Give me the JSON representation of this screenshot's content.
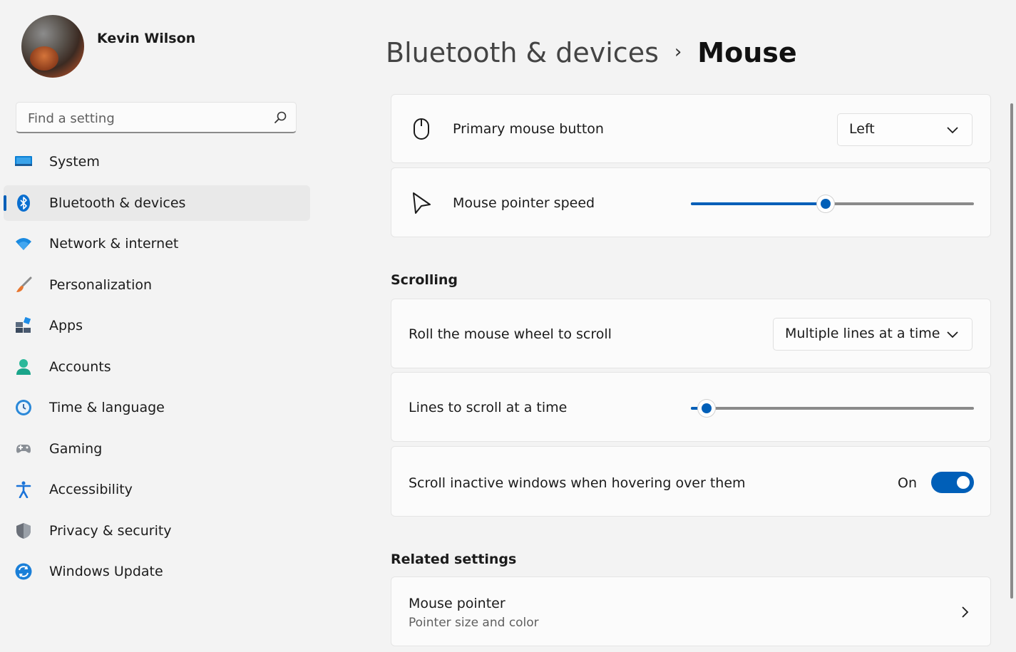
{
  "user": {
    "name": "Kevin Wilson"
  },
  "search": {
    "placeholder": "Find a setting"
  },
  "nav": [
    {
      "label": "System",
      "icon": "system-icon"
    },
    {
      "label": "Bluetooth & devices",
      "icon": "bluetooth-icon",
      "active": true
    },
    {
      "label": "Network & internet",
      "icon": "wifi-icon"
    },
    {
      "label": "Personalization",
      "icon": "brush-icon"
    },
    {
      "label": "Apps",
      "icon": "apps-icon"
    },
    {
      "label": "Accounts",
      "icon": "accounts-icon"
    },
    {
      "label": "Time & language",
      "icon": "time-language-icon"
    },
    {
      "label": "Gaming",
      "icon": "gaming-icon"
    },
    {
      "label": "Accessibility",
      "icon": "accessibility-icon"
    },
    {
      "label": "Privacy & security",
      "icon": "shield-icon"
    },
    {
      "label": "Windows Update",
      "icon": "update-icon"
    }
  ],
  "breadcrumb": {
    "parent": "Bluetooth & devices",
    "separator": "›",
    "current": "Mouse"
  },
  "settings": {
    "primary_button": {
      "label": "Primary mouse button",
      "value": "Left",
      "icon": "mouse-icon"
    },
    "pointer_speed": {
      "label": "Mouse pointer speed",
      "value_fraction": 0.475,
      "icon": "pointer-icon"
    }
  },
  "scrolling": {
    "title": "Scrolling",
    "roll_wheel": {
      "label": "Roll the mouse wheel to scroll",
      "value": "Multiple lines at a time"
    },
    "lines_to_scroll": {
      "label": "Lines to scroll at a time",
      "value_fraction": 0.055
    },
    "inactive_scroll": {
      "label": "Scroll inactive windows when hovering over them",
      "state": "On",
      "on": true
    }
  },
  "related": {
    "title": "Related settings",
    "mouse_pointer": {
      "label": "Mouse pointer",
      "sublabel": "Pointer size and color"
    }
  },
  "colors": {
    "accent": "#005fb8",
    "background": "#f3f3f3",
    "card": "#fbfbfb"
  }
}
